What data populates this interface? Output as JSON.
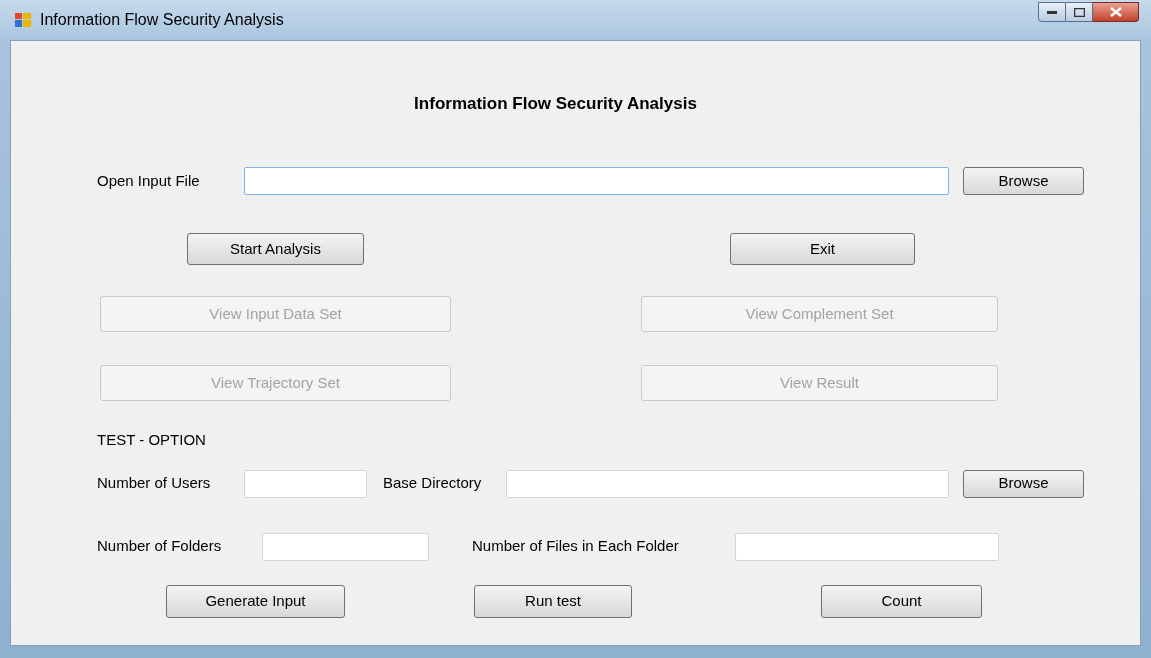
{
  "window": {
    "title": "Information Flow Security Analysis"
  },
  "heading": "Information Flow Security Analysis",
  "input_file": {
    "label": "Open Input File",
    "focused": true,
    "browse": "Browse"
  },
  "actions": [
    {
      "label": "Start Analysis",
      "disabled": false
    },
    {
      "label": "Exit",
      "disabled": false
    }
  ],
  "views": [
    {
      "label": "View Input Data Set",
      "disabled": true
    },
    {
      "label": "View Complement Set",
      "disabled": true
    },
    {
      "label": "View Trajectory Set",
      "disabled": true
    },
    {
      "label": "View Result",
      "disabled": true
    }
  ],
  "test_option": {
    "title": "TEST - OPTION",
    "fields": [
      {
        "label": "Number of Users",
        "focused": false
      },
      {
        "label": "Base Directory",
        "focused": false
      },
      {
        "label": "Number of Folders",
        "focused": false
      },
      {
        "label": "Number of Files in Each Folder",
        "focused": false
      }
    ],
    "browse": "Browse",
    "buttons": [
      {
        "label": "Generate Input",
        "disabled": false
      },
      {
        "label": "Run test",
        "disabled": false
      },
      {
        "label": "Count",
        "disabled": false
      }
    ]
  }
}
